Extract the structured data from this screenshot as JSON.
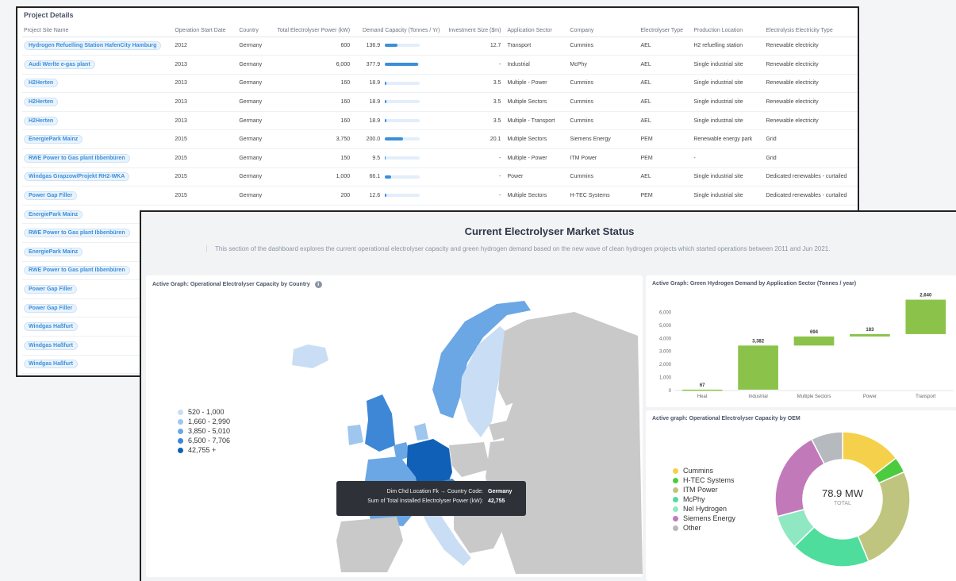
{
  "project_details": {
    "title": "Project Details",
    "columns": [
      "Project Site Name",
      "Operation Start Date",
      "Country",
      "Total Electrolyser Power (kW)",
      "Demand Capacity (Tonnes / Yr)",
      "Investment Size ($m)",
      "Application Sector",
      "Company",
      "Electrolyser Type",
      "Production Location",
      "Electrolysis Electricity Type"
    ],
    "rows": [
      {
        "name": "Hydrogen Refuelling Station HafenCity Hamburg",
        "year": "2012",
        "country": "Germany",
        "power": "600",
        "demand": "136.9",
        "demand_frac": 0.35,
        "invest": "12.7",
        "sector": "Transport",
        "company": "Cummins",
        "type": "AEL",
        "location": "H2 refuelling station",
        "electricity": "Renewable electricity"
      },
      {
        "name": "Audi Werlte e-gas plant",
        "year": "2013",
        "country": "Germany",
        "power": "6,000",
        "demand": "377.9",
        "demand_frac": 0.95,
        "invest": "-",
        "sector": "Industrial",
        "company": "McPhy",
        "type": "AEL",
        "location": "Single industrial site",
        "electricity": "Renewable electricity"
      },
      {
        "name": "H2Herten",
        "year": "2013",
        "country": "Germany",
        "power": "160",
        "demand": "18.9",
        "demand_frac": 0.05,
        "invest": "3.5",
        "sector": "Multiple - Power",
        "company": "Cummins",
        "type": "AEL",
        "location": "Single industrial site",
        "electricity": "Renewable electricity"
      },
      {
        "name": "H2Herten",
        "year": "2013",
        "country": "Germany",
        "power": "160",
        "demand": "18.9",
        "demand_frac": 0.05,
        "invest": "3.5",
        "sector": "Multiple Sectors",
        "company": "Cummins",
        "type": "AEL",
        "location": "Single industrial site",
        "electricity": "Renewable electricity"
      },
      {
        "name": "H2Herten",
        "year": "2013",
        "country": "Germany",
        "power": "160",
        "demand": "18.9",
        "demand_frac": 0.05,
        "invest": "3.5",
        "sector": "Multiple - Transport",
        "company": "Cummins",
        "type": "AEL",
        "location": "Single industrial site",
        "electricity": "Renewable electricity"
      },
      {
        "name": "EnergiePark Mainz",
        "year": "2015",
        "country": "Germany",
        "power": "3,750",
        "demand": "200.0",
        "demand_frac": 0.52,
        "invest": "20.1",
        "sector": "Multiple Sectors",
        "company": "Siemens Energy",
        "type": "PEM",
        "location": "Renewable energy park",
        "electricity": "Grid"
      },
      {
        "name": "RWE Power to Gas plant Ibbenbüren",
        "year": "2015",
        "country": "Germany",
        "power": "150",
        "demand": "9.5",
        "demand_frac": 0.03,
        "invest": "-",
        "sector": "Multiple - Power",
        "company": "ITM Power",
        "type": "PEM",
        "location": "-",
        "electricity": "Grid"
      },
      {
        "name": "Windgas Grapzow/Projekt RH2-WKA",
        "year": "2015",
        "country": "Germany",
        "power": "1,000",
        "demand": "66.1",
        "demand_frac": 0.17,
        "invest": "-",
        "sector": "Power",
        "company": "Cummins",
        "type": "AEL",
        "location": "Single industrial site",
        "electricity": "Dedicated renewables - curtailed"
      },
      {
        "name": "Power Gap Filler",
        "year": "2015",
        "country": "Germany",
        "power": "200",
        "demand": "12.6",
        "demand_frac": 0.04,
        "invest": "-",
        "sector": "Multiple Sectors",
        "company": "H-TEC Systems",
        "type": "PEM",
        "location": "Single industrial site",
        "electricity": "Dedicated renewables - curtailed"
      },
      {
        "name": "EnergiePark Mainz"
      },
      {
        "name": "RWE Power to Gas plant Ibbenbüren"
      },
      {
        "name": "EnergiePark Mainz"
      },
      {
        "name": "RWE Power to Gas plant Ibbenbüren"
      },
      {
        "name": "Power Gap Filler"
      },
      {
        "name": "Power Gap Filler"
      },
      {
        "name": "Windgas Haßfurt"
      },
      {
        "name": "Windgas Haßfurt"
      },
      {
        "name": "Windgas Haßfurt"
      }
    ]
  },
  "dashboard": {
    "title": "Current Electrolyser Market Status",
    "description": "This section of the dashboard explores the current operational electrolyser capacity and green hydrogen demand based on the new wave of clean hydrogen projects which started operations between 2011 and Jun 2021."
  },
  "map_card": {
    "title": "Active Graph: Operational Electrolyser Capacity by Country",
    "info_icon": "info-icon",
    "legend": [
      {
        "label": "520 - 1,000",
        "color": "#c9def4"
      },
      {
        "label": "1,660 - 2,990",
        "color": "#9ec6ee"
      },
      {
        "label": "3,850 - 5,010",
        "color": "#6aa7e4"
      },
      {
        "label": "6,500 - 7,706",
        "color": "#3d87d6"
      },
      {
        "label": "42,755 +",
        "color": "#1060b8"
      }
    ],
    "tooltip": {
      "key1": "Dim Chd Location Fk → Country Code:",
      "val1": "Germany",
      "key2": "Sum of Total Installed Electrolyser Power (kW):",
      "val2": "42,755"
    }
  },
  "waterfall_card": {
    "title": "Active Graph: Green Hydrogen Demand by Application Sector (Tonnes / year)"
  },
  "donut_card": {
    "title": "Active graph: Operational Electrolyser Capacity by OEM",
    "center_value": "78.9 MW",
    "center_label": "TOTAL"
  },
  "chart_data": [
    {
      "type": "bar",
      "subtype": "waterfall",
      "title": "Active Graph: Green Hydrogen Demand by Application Sector (Tonnes / year)",
      "categories": [
        "Heat",
        "Industrial",
        "Multiple Sectors",
        "Power",
        "Transport"
      ],
      "values": [
        67,
        3382,
        694,
        183,
        2640
      ],
      "value_labels": [
        "67",
        "3,382",
        "694",
        "183",
        "2,640"
      ],
      "yticks": [
        "0",
        "1,000",
        "2,000",
        "3,000",
        "4,000",
        "5,000",
        "6,000"
      ],
      "ylim": [
        0,
        7000
      ],
      "color": "#8bc34a"
    },
    {
      "type": "pie",
      "subtype": "donut",
      "title": "Active graph: Operational Electrolyser Capacity by OEM",
      "categories": [
        "Cummins",
        "H-TEC Systems",
        "ITM Power",
        "McPhy",
        "Nel Hydrogen",
        "Siemens Energy",
        "Other"
      ],
      "values": [
        11.5,
        3.0,
        20.0,
        15.0,
        6.5,
        17.0,
        6.0
      ],
      "colors": [
        "#f5d04a",
        "#4ccb3f",
        "#bfc47f",
        "#4edd9c",
        "#8fe8c2",
        "#c279b9",
        "#b6b9bd"
      ]
    }
  ]
}
